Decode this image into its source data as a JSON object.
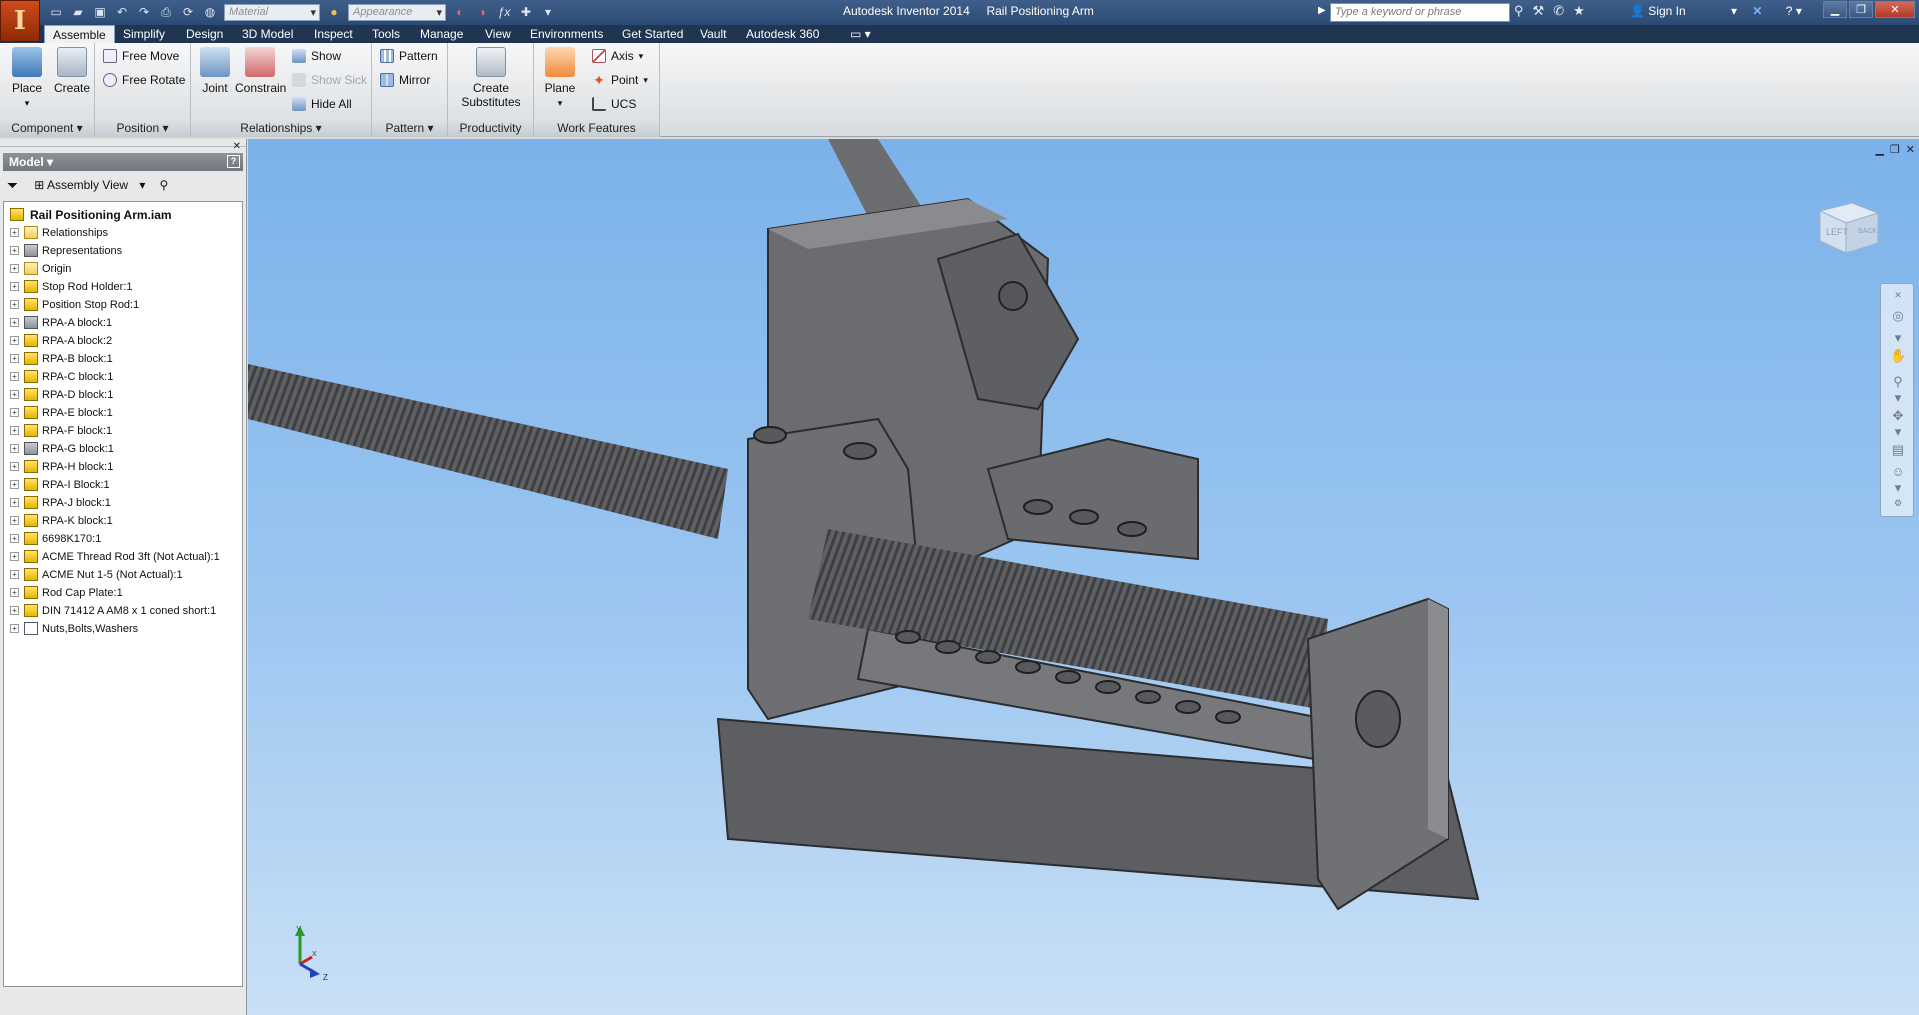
{
  "app": {
    "product": "Autodesk Inventor 2014",
    "document": "Rail Positioning Arm"
  },
  "quick_access": {
    "material_placeholder": "Material",
    "appearance_placeholder": "Appearance"
  },
  "search": {
    "placeholder": "Type a keyword or phrase"
  },
  "account": {
    "sign_in": "Sign In"
  },
  "tabs": [
    {
      "label": "Assemble",
      "active": true
    },
    {
      "label": "Simplify"
    },
    {
      "label": "Design"
    },
    {
      "label": "3D Model"
    },
    {
      "label": "Inspect"
    },
    {
      "label": "Tools"
    },
    {
      "label": "Manage"
    },
    {
      "label": "View"
    },
    {
      "label": "Environments"
    },
    {
      "label": "Get Started"
    },
    {
      "label": "Vault"
    },
    {
      "label": "Autodesk 360"
    }
  ],
  "ribbon": {
    "component": {
      "label": "Component",
      "place": "Place",
      "create": "Create"
    },
    "position": {
      "label": "Position",
      "free_move": "Free Move",
      "free_rotate": "Free Rotate"
    },
    "relationships": {
      "label": "Relationships",
      "joint": "Joint",
      "constrain": "Constrain",
      "show": "Show",
      "show_sick": "Show Sick",
      "hide_all": "Hide All"
    },
    "pattern": {
      "label": "Pattern",
      "pattern": "Pattern",
      "mirror": "Mirror"
    },
    "productivity": {
      "label": "Productivity",
      "create_substitutes_1": "Create",
      "create_substitutes_2": "Substitutes"
    },
    "work_features": {
      "label": "Work Features",
      "plane": "Plane",
      "axis": "Axis",
      "point": "Point",
      "ucs": "UCS"
    }
  },
  "browser": {
    "header": "Model",
    "view_mode": "Assembly View",
    "root": "Rail Positioning Arm.iam",
    "items": [
      {
        "label": "Relationships",
        "icon": "folder-icon"
      },
      {
        "label": "Representations",
        "icon": "representations-icon"
      },
      {
        "label": "Origin",
        "icon": "folder-icon"
      },
      {
        "label": "Stop Rod Holder:1",
        "icon": "part-icon"
      },
      {
        "label": "Position Stop Rod:1",
        "icon": "part-icon"
      },
      {
        "label": "RPA-A block:1",
        "icon": "part-gray-icon"
      },
      {
        "label": "RPA-A block:2",
        "icon": "part-icon"
      },
      {
        "label": "RPA-B block:1",
        "icon": "part-icon"
      },
      {
        "label": "RPA-C block:1",
        "icon": "part-icon"
      },
      {
        "label": "RPA-D block:1",
        "icon": "part-icon"
      },
      {
        "label": "RPA-E block:1",
        "icon": "part-icon"
      },
      {
        "label": "RPA-F block:1",
        "icon": "part-icon"
      },
      {
        "label": "RPA-G block:1",
        "icon": "part-gray-icon"
      },
      {
        "label": "RPA-H block:1",
        "icon": "part-icon"
      },
      {
        "label": "RPA-I Block:1",
        "icon": "part-icon"
      },
      {
        "label": "RPA-J block:1",
        "icon": "part-icon"
      },
      {
        "label": "RPA-K block:1",
        "icon": "part-icon"
      },
      {
        "label": "6698K170:1",
        "icon": "part-icon"
      },
      {
        "label": "ACME Thread Rod 3ft (Not Actual):1",
        "icon": "part-icon"
      },
      {
        "label": "ACME Nut 1-5 (Not Actual):1",
        "icon": "part-icon"
      },
      {
        "label": "Rod Cap Plate:1",
        "icon": "part-icon"
      },
      {
        "label": "DIN 71412 A AM8 x 1 coned short:1",
        "icon": "part-icon"
      },
      {
        "label": "Nuts,Bolts,Washers",
        "icon": "doc-icon"
      }
    ]
  },
  "viewcube": {
    "face_label": "LEFT",
    "side_label": "BACK"
  },
  "triad": {
    "y": "Y",
    "x": "X",
    "z": "Z"
  },
  "colors": {
    "title_bar": "#2b4a73",
    "viewport_top": "#7bb2ea",
    "viewport_bottom": "#c9e0f6",
    "model_gray": "#6e6f72"
  }
}
